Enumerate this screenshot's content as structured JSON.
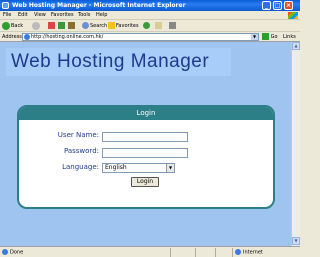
{
  "window": {
    "title": "Web Hosting Manager - Microsoft Internet Explorer"
  },
  "menu": [
    "File",
    "Edit",
    "View",
    "Favorites",
    "Tools",
    "Help"
  ],
  "toolbar": {
    "back_label": "Back",
    "search_label": "Search",
    "favorites_label": "Favorites"
  },
  "address": {
    "label": "Address",
    "url": "http://hosting.online.com.hk/",
    "go_label": "Go",
    "links_label": "Links"
  },
  "banner": {
    "text": "Web Hosting Manager"
  },
  "login": {
    "title": "Login",
    "username_label": "User Name:",
    "username_value": "",
    "password_label": "Password:",
    "password_value": "",
    "language_label": "Language:",
    "language_value": "English",
    "button_label": "Login"
  },
  "status": {
    "left": "Done",
    "zone": "Internet"
  }
}
